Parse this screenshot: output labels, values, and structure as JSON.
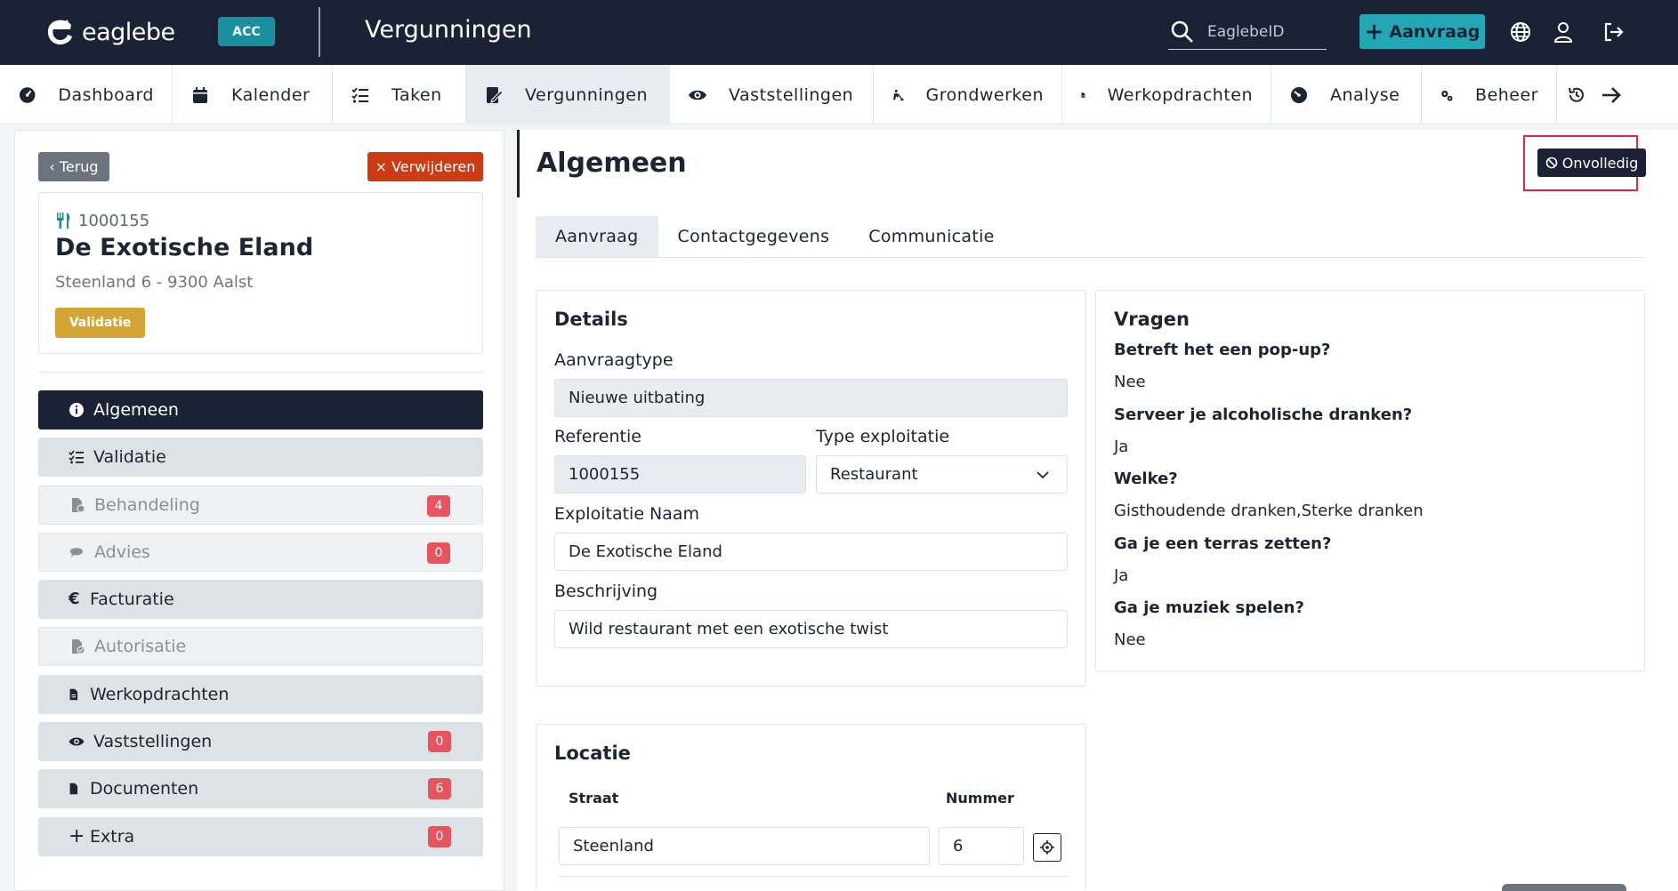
{
  "app": {
    "logo_text": "eaglebe",
    "env_badge": "ACC",
    "title": "Vergunningen",
    "search_placeholder": "EaglebeID",
    "new_request_label": "Aanvraag"
  },
  "nav": {
    "items": [
      {
        "label": "Dashboard",
        "icon": "dashboard-icon"
      },
      {
        "label": "Kalender",
        "icon": "calendar-icon"
      },
      {
        "label": "Taken",
        "icon": "tasks-icon"
      },
      {
        "label": "Vergunningen",
        "icon": "permit-icon",
        "active": true
      },
      {
        "label": "Vaststellingen",
        "icon": "eye-icon"
      },
      {
        "label": "Grondwerken",
        "icon": "digging-icon"
      },
      {
        "label": "Werkopdrachten",
        "icon": "file-icon"
      },
      {
        "label": "Analyse",
        "icon": "gauge-icon"
      },
      {
        "label": "Beheer",
        "icon": "cogs-icon"
      }
    ]
  },
  "sidebar": {
    "back_label": "Terug",
    "delete_label": "Verwijderen",
    "card": {
      "reference": "1000155",
      "name": "De Exotische Eland",
      "address": "Steenland 6 - 9300 Aalst",
      "status": "Validatie",
      "status_color": "#d4a535"
    },
    "menu": [
      {
        "label": "Algemeen",
        "icon": "info-icon",
        "state": "active"
      },
      {
        "label": "Validatie",
        "icon": "checklist-icon",
        "state": "normal"
      },
      {
        "label": "Behandeling",
        "icon": "file-gear-icon",
        "state": "disabled",
        "count": "4"
      },
      {
        "label": "Advies",
        "icon": "comments-icon",
        "state": "disabled",
        "count": "0"
      },
      {
        "label": "Facturatie",
        "icon": "euro-icon",
        "state": "normal"
      },
      {
        "label": "Autorisatie",
        "icon": "file-check-icon",
        "state": "disabled"
      },
      {
        "label": "Werkopdrachten",
        "icon": "file-icon",
        "state": "normal"
      },
      {
        "label": "Vaststellingen",
        "icon": "eye-icon",
        "state": "normal",
        "count": "0"
      },
      {
        "label": "Documenten",
        "icon": "document-icon",
        "state": "normal",
        "count": "6"
      },
      {
        "label": "Extra",
        "icon": "plus-icon",
        "state": "normal",
        "count": "0"
      }
    ]
  },
  "main": {
    "title": "Algemeen",
    "status_button": "Onvolledig",
    "tabs": [
      "Aanvraag",
      "Contactgegevens",
      "Communicatie"
    ],
    "details": {
      "heading": "Details",
      "request_type_label": "Aanvraagtype",
      "request_type_value": "Nieuwe uitbating",
      "reference_label": "Referentie",
      "reference_value": "1000155",
      "exploitation_type_label": "Type exploitatie",
      "exploitation_type_value": "Restaurant",
      "exploitation_name_label": "Exploitatie Naam",
      "exploitation_name_value": "De Exotische Eland",
      "description_label": "Beschrijving",
      "description_value": "Wild restaurant met een exotische twist"
    },
    "questions": {
      "heading": "Vragen",
      "items": [
        {
          "q": "Betreft het een pop-up?",
          "a": "Nee"
        },
        {
          "q": "Serveer je alcoholische dranken?",
          "a": "Ja"
        },
        {
          "q": "Welke?",
          "a": "Gisthoudende dranken,Sterke dranken"
        },
        {
          "q": "Ga je een terras zetten?",
          "a": "Ja"
        },
        {
          "q": "Ga je muziek spelen?",
          "a": "Nee"
        }
      ]
    },
    "location": {
      "heading": "Locatie",
      "street_header": "Straat",
      "number_header": "Nummer",
      "street_value": "Steenland",
      "number_value": "6"
    }
  },
  "colors": {
    "topbar": "#1b2236",
    "accent": "#23a7b5",
    "danger": "#cc3b12",
    "badge": "#e8545e",
    "highlight": "#e0283a"
  }
}
